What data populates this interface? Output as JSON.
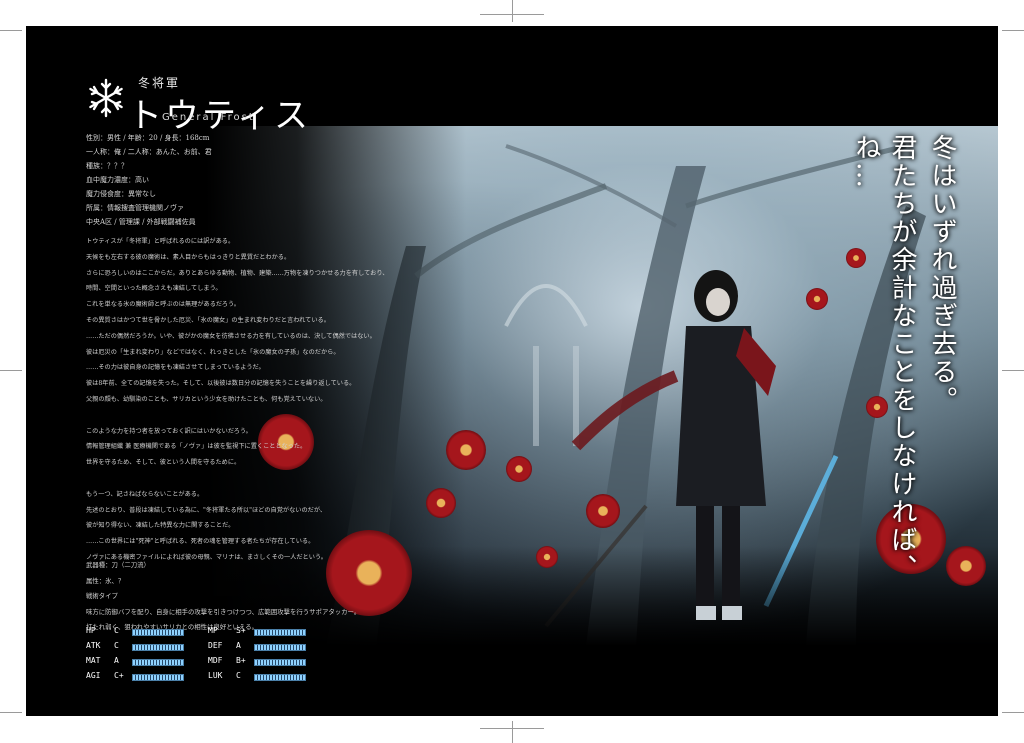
{
  "character": {
    "title_prefix": "冬将軍",
    "name": "トウティス",
    "name_en": "General Frost"
  },
  "profile": [
    "性別：男性 / 年齢：20 / 身長：168cm",
    "一人称：俺 / 二人称：あんた、お前、君",
    "種族：？？？",
    "血中魔力濃度：高い",
    "魔力侵食度：異常なし",
    "所属：情報捜査管理機関ノヴァ",
    "中央A区 / 管理課 / 外部戦闘補佐員"
  ],
  "story": [
    "トウティスが「冬将軍」と呼ばれるのには訳がある。",
    "天候をも左右する彼の魔術は、素人目からもはっきりと異質だとわかる。",
    "さらに恐ろしいのはここからだ。ありとあらゆる動物、植物、建築……万物を凍りつかせる力を有しており、",
    "時間、空間といった概念さえも凍結してしまう。",
    "これを単なる氷の魔術師と呼ぶのは無理があるだろう。",
    "その異質さはかつて世を脅かした厄災、「氷の魔女」の生まれ変わりだと言われている。",
    "……ただの偶然だろうか。いや、彼がかの魔女を彷彿させる力を有しているのは、決して偶然ではない。",
    "彼は厄災の「生まれ変わり」などではなく、れっきとした「氷の魔女の子孫」なのだから。",
    "……その力は彼自身の記憶をも凍結させてしまっているようだ。",
    "彼は8年前、全ての記憶を失った。そして、以後彼は数日分の記憶を失うことを繰り返している。",
    "父親の顔も、幼馴染のことも、サリカという少女を助けたことも、何も覚えていない。",
    "",
    "このような力を持つ者を放っておく訳にはいかないだろう。",
    "情報管理組織 兼 医療機関である「ノヴァ」は彼を監視下に置くこととなった。",
    "世界を守るため、そして、彼という人間を守るために。",
    "",
    "もう一つ、記さねばならないことがある。",
    "先述のとおり、普段は凍結している為に、\"冬将軍たる所以\"ほどの自覚がないのだが、",
    "彼が知り得ない、凍結した特異な力に関することだ。",
    "……この世界には\"死神\"と呼ばれる、死者の魂を管理する者たちが存在している。",
    "ノヴァにある機密ファイルによれば彼の母親、マリナは、まさしくその一人だという。"
  ],
  "weapon": [
    "武器種：刀（二刀流）",
    "属性：氷、？",
    "戦術タイプ",
    "味方に防御バフを配り、自身に相手の攻撃を引きつけつつ、広範囲攻撃を行うサポアタッカー。",
    "打たれ弱く、狙われやすいサリカとの相性は良好といえる。"
  ],
  "stats": [
    {
      "abbr": "HP",
      "grade": "C"
    },
    {
      "abbr": "ATK",
      "grade": "C"
    },
    {
      "abbr": "MAT",
      "grade": "A"
    },
    {
      "abbr": "AGI",
      "grade": "C+"
    },
    {
      "abbr": "MP",
      "grade": "S+"
    },
    {
      "abbr": "DEF",
      "grade": "A"
    },
    {
      "abbr": "MDF",
      "grade": "B+"
    },
    {
      "abbr": "LUK",
      "grade": "C"
    }
  ],
  "tagline": {
    "line1": "冬はいずれ過ぎ去る。",
    "line2": "君たちが余計なことをしなければ、ね…"
  },
  "colors": {
    "background": "#000000",
    "stat_bar": "#8fd2ff",
    "flower": "#a5161c"
  }
}
